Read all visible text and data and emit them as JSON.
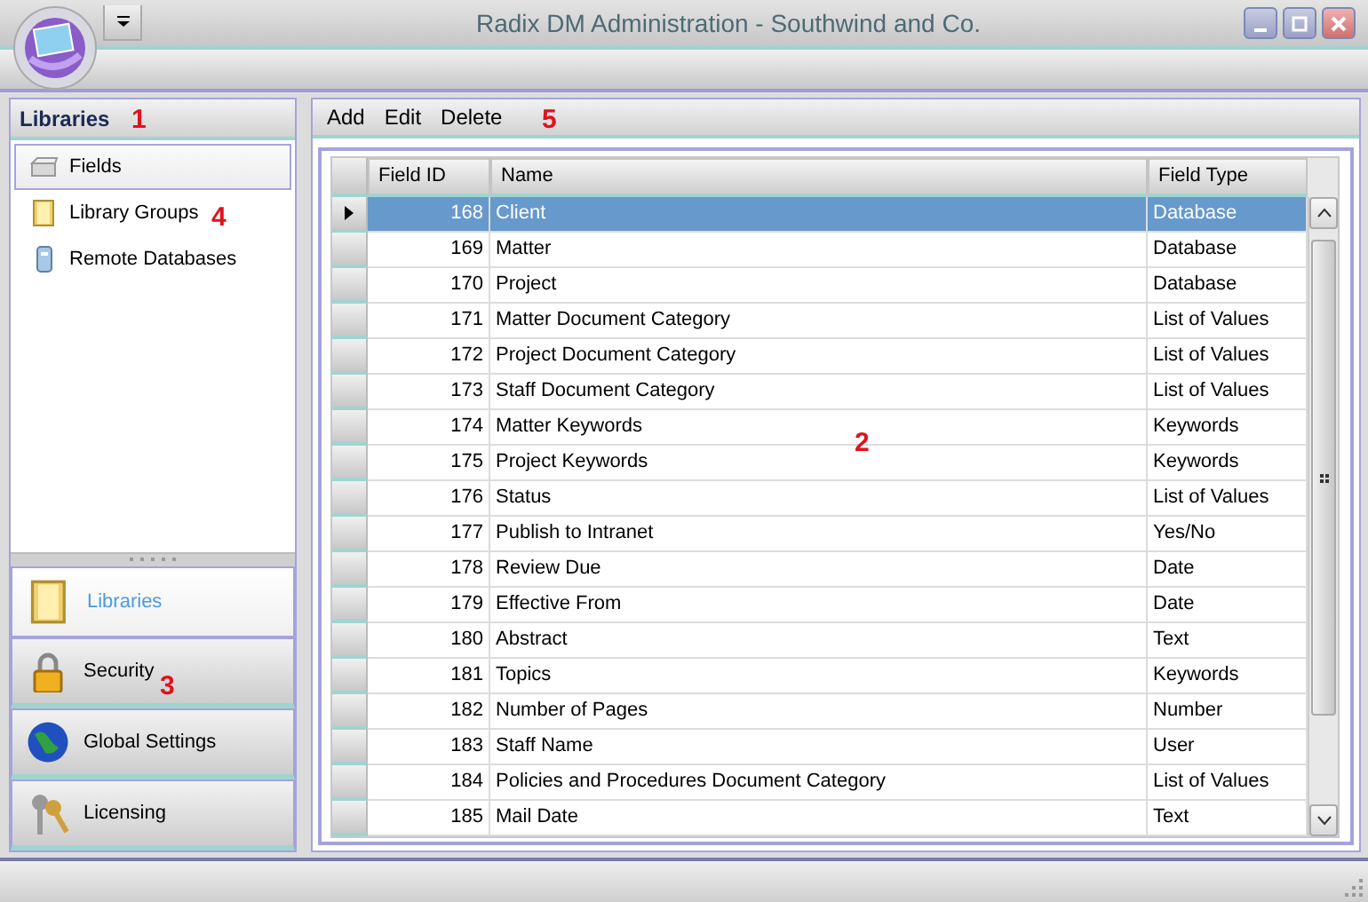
{
  "window": {
    "title": "Radix DM Administration - Southwind and Co."
  },
  "sidebar": {
    "header": "Libraries",
    "items": [
      {
        "label": "Fields",
        "selected": true
      },
      {
        "label": "Library Groups",
        "selected": false
      },
      {
        "label": "Remote Databases",
        "selected": false
      }
    ],
    "nav_buttons": [
      {
        "label": "Libraries",
        "selected": true
      },
      {
        "label": "Security",
        "selected": false
      },
      {
        "label": "Global Settings",
        "selected": false
      },
      {
        "label": "Licensing",
        "selected": false
      }
    ]
  },
  "toolbar": [
    "Add",
    "Edit",
    "Delete"
  ],
  "table": {
    "columns": [
      "Field ID",
      "Name",
      "Field Type"
    ],
    "rows": [
      {
        "cells": [
          "168",
          "Client",
          "Database"
        ],
        "selected": true
      },
      {
        "cells": [
          "169",
          "Matter",
          "Database"
        ],
        "selected": false
      },
      {
        "cells": [
          "170",
          "Project",
          "Database"
        ],
        "selected": false
      },
      {
        "cells": [
          "171",
          "Matter Document Category",
          "List of Values"
        ],
        "selected": false
      },
      {
        "cells": [
          "172",
          "Project Document Category",
          "List of Values"
        ],
        "selected": false
      },
      {
        "cells": [
          "173",
          "Staff Document Category",
          "List of Values"
        ],
        "selected": false
      },
      {
        "cells": [
          "174",
          "Matter Keywords",
          "Keywords"
        ],
        "selected": false
      },
      {
        "cells": [
          "175",
          "Project Keywords",
          "Keywords"
        ],
        "selected": false
      },
      {
        "cells": [
          "176",
          "Status",
          "List of Values"
        ],
        "selected": false
      },
      {
        "cells": [
          "177",
          "Publish to Intranet",
          "Yes/No"
        ],
        "selected": false
      },
      {
        "cells": [
          "178",
          "Review Due",
          "Date"
        ],
        "selected": false
      },
      {
        "cells": [
          "179",
          "Effective From",
          "Date"
        ],
        "selected": false
      },
      {
        "cells": [
          "180",
          "Abstract",
          "Text"
        ],
        "selected": false
      },
      {
        "cells": [
          "181",
          "Topics",
          "Keywords"
        ],
        "selected": false
      },
      {
        "cells": [
          "182",
          "Number of Pages",
          "Number"
        ],
        "selected": false
      },
      {
        "cells": [
          "183",
          "Staff Name",
          "User"
        ],
        "selected": false
      },
      {
        "cells": [
          "184",
          "Policies and Procedures Document Category",
          "List of Values"
        ],
        "selected": false
      },
      {
        "cells": [
          "185",
          "Mail Date",
          "Text"
        ],
        "selected": false
      }
    ]
  },
  "annotations": [
    "1",
    "2",
    "3",
    "4",
    "5"
  ]
}
